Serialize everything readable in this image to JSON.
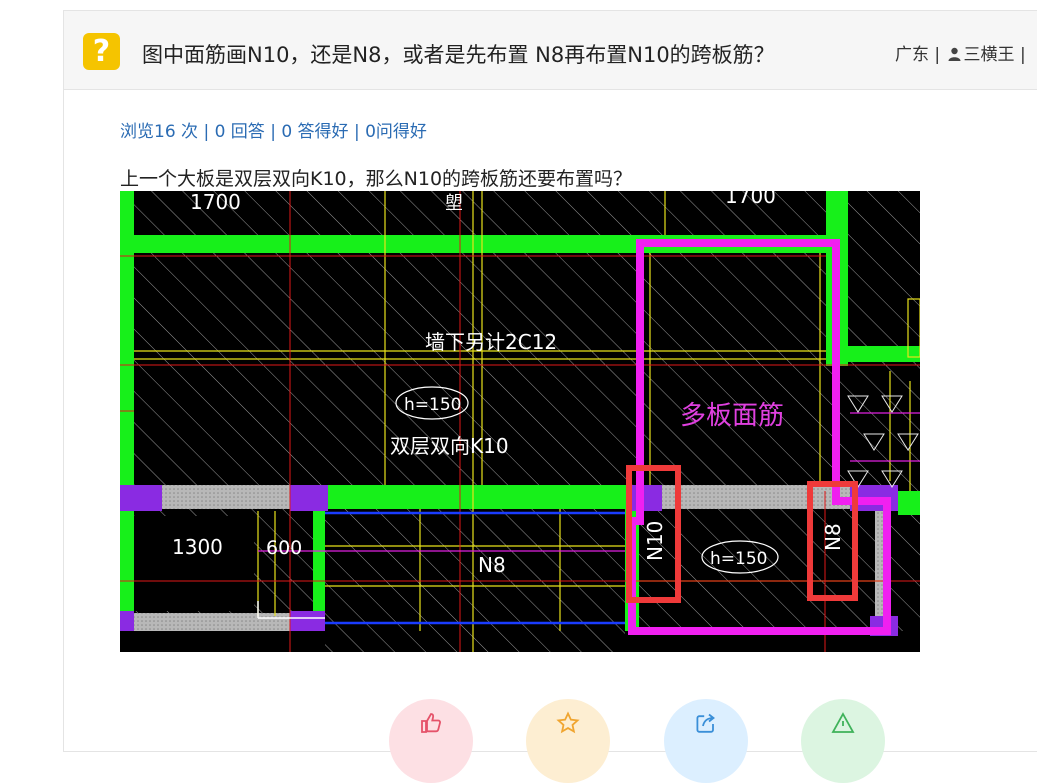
{
  "question": {
    "title": "图中面筋画N10，还是N8，或者是先布置 N8再布置N10的跨板筋？",
    "location": "广东",
    "author": "三横王",
    "meta_separator": "|",
    "icon": "question-mark-icon",
    "icon_char": "?"
  },
  "stats": {
    "text": "浏览16 次 | 0 回答 | 0 答得好 | 0问得好"
  },
  "description": "上一个大板是双层双向K10，那么N10的跨板筋还要布置吗？",
  "drawing": {
    "labels": {
      "dim_1700_left": "1700",
      "dim_1700_right": "1700",
      "wall_note": "墙下另计2C12",
      "h150_top": "h=150",
      "double_k10": "双层双向K10",
      "multi_slab": "多板面筋",
      "dim_1300": "1300",
      "dim_600": "600",
      "n8_mid": "N8",
      "n10": "N10",
      "h150_bottom": "h=150",
      "n8_right": "N8",
      "cut_top": "塱"
    }
  },
  "actions": [
    {
      "name": "like",
      "icon": "thumbs-up-icon",
      "bg": "#fde0e4",
      "color": "#e5536a"
    },
    {
      "name": "favorite",
      "icon": "star-icon",
      "bg": "#fdeed2",
      "color": "#f0a530"
    },
    {
      "name": "share",
      "icon": "share-icon",
      "bg": "#dcefff",
      "color": "#3a8fd8"
    },
    {
      "name": "report",
      "icon": "warning-icon",
      "bg": "#dcf5e1",
      "color": "#3fb25a"
    }
  ]
}
